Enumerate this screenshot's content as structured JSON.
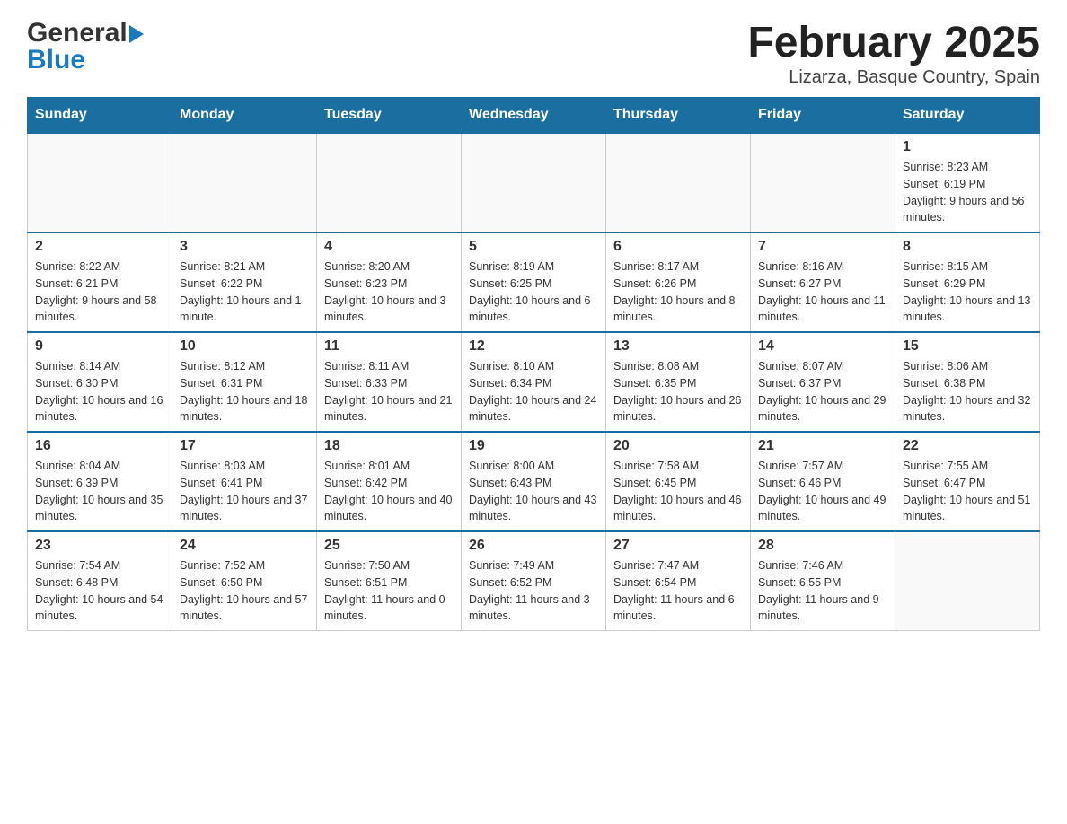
{
  "header": {
    "logo_general": "General",
    "logo_blue": "Blue",
    "title": "February 2025",
    "subtitle": "Lizarza, Basque Country, Spain"
  },
  "days_of_week": [
    "Sunday",
    "Monday",
    "Tuesday",
    "Wednesday",
    "Thursday",
    "Friday",
    "Saturday"
  ],
  "weeks": [
    [
      {
        "day": "",
        "info": ""
      },
      {
        "day": "",
        "info": ""
      },
      {
        "day": "",
        "info": ""
      },
      {
        "day": "",
        "info": ""
      },
      {
        "day": "",
        "info": ""
      },
      {
        "day": "",
        "info": ""
      },
      {
        "day": "1",
        "info": "Sunrise: 8:23 AM\nSunset: 6:19 PM\nDaylight: 9 hours and 56 minutes."
      }
    ],
    [
      {
        "day": "2",
        "info": "Sunrise: 8:22 AM\nSunset: 6:21 PM\nDaylight: 9 hours and 58 minutes."
      },
      {
        "day": "3",
        "info": "Sunrise: 8:21 AM\nSunset: 6:22 PM\nDaylight: 10 hours and 1 minute."
      },
      {
        "day": "4",
        "info": "Sunrise: 8:20 AM\nSunset: 6:23 PM\nDaylight: 10 hours and 3 minutes."
      },
      {
        "day": "5",
        "info": "Sunrise: 8:19 AM\nSunset: 6:25 PM\nDaylight: 10 hours and 6 minutes."
      },
      {
        "day": "6",
        "info": "Sunrise: 8:17 AM\nSunset: 6:26 PM\nDaylight: 10 hours and 8 minutes."
      },
      {
        "day": "7",
        "info": "Sunrise: 8:16 AM\nSunset: 6:27 PM\nDaylight: 10 hours and 11 minutes."
      },
      {
        "day": "8",
        "info": "Sunrise: 8:15 AM\nSunset: 6:29 PM\nDaylight: 10 hours and 13 minutes."
      }
    ],
    [
      {
        "day": "9",
        "info": "Sunrise: 8:14 AM\nSunset: 6:30 PM\nDaylight: 10 hours and 16 minutes."
      },
      {
        "day": "10",
        "info": "Sunrise: 8:12 AM\nSunset: 6:31 PM\nDaylight: 10 hours and 18 minutes."
      },
      {
        "day": "11",
        "info": "Sunrise: 8:11 AM\nSunset: 6:33 PM\nDaylight: 10 hours and 21 minutes."
      },
      {
        "day": "12",
        "info": "Sunrise: 8:10 AM\nSunset: 6:34 PM\nDaylight: 10 hours and 24 minutes."
      },
      {
        "day": "13",
        "info": "Sunrise: 8:08 AM\nSunset: 6:35 PM\nDaylight: 10 hours and 26 minutes."
      },
      {
        "day": "14",
        "info": "Sunrise: 8:07 AM\nSunset: 6:37 PM\nDaylight: 10 hours and 29 minutes."
      },
      {
        "day": "15",
        "info": "Sunrise: 8:06 AM\nSunset: 6:38 PM\nDaylight: 10 hours and 32 minutes."
      }
    ],
    [
      {
        "day": "16",
        "info": "Sunrise: 8:04 AM\nSunset: 6:39 PM\nDaylight: 10 hours and 35 minutes."
      },
      {
        "day": "17",
        "info": "Sunrise: 8:03 AM\nSunset: 6:41 PM\nDaylight: 10 hours and 37 minutes."
      },
      {
        "day": "18",
        "info": "Sunrise: 8:01 AM\nSunset: 6:42 PM\nDaylight: 10 hours and 40 minutes."
      },
      {
        "day": "19",
        "info": "Sunrise: 8:00 AM\nSunset: 6:43 PM\nDaylight: 10 hours and 43 minutes."
      },
      {
        "day": "20",
        "info": "Sunrise: 7:58 AM\nSunset: 6:45 PM\nDaylight: 10 hours and 46 minutes."
      },
      {
        "day": "21",
        "info": "Sunrise: 7:57 AM\nSunset: 6:46 PM\nDaylight: 10 hours and 49 minutes."
      },
      {
        "day": "22",
        "info": "Sunrise: 7:55 AM\nSunset: 6:47 PM\nDaylight: 10 hours and 51 minutes."
      }
    ],
    [
      {
        "day": "23",
        "info": "Sunrise: 7:54 AM\nSunset: 6:48 PM\nDaylight: 10 hours and 54 minutes."
      },
      {
        "day": "24",
        "info": "Sunrise: 7:52 AM\nSunset: 6:50 PM\nDaylight: 10 hours and 57 minutes."
      },
      {
        "day": "25",
        "info": "Sunrise: 7:50 AM\nSunset: 6:51 PM\nDaylight: 11 hours and 0 minutes."
      },
      {
        "day": "26",
        "info": "Sunrise: 7:49 AM\nSunset: 6:52 PM\nDaylight: 11 hours and 3 minutes."
      },
      {
        "day": "27",
        "info": "Sunrise: 7:47 AM\nSunset: 6:54 PM\nDaylight: 11 hours and 6 minutes."
      },
      {
        "day": "28",
        "info": "Sunrise: 7:46 AM\nSunset: 6:55 PM\nDaylight: 11 hours and 9 minutes."
      },
      {
        "day": "",
        "info": ""
      }
    ]
  ]
}
